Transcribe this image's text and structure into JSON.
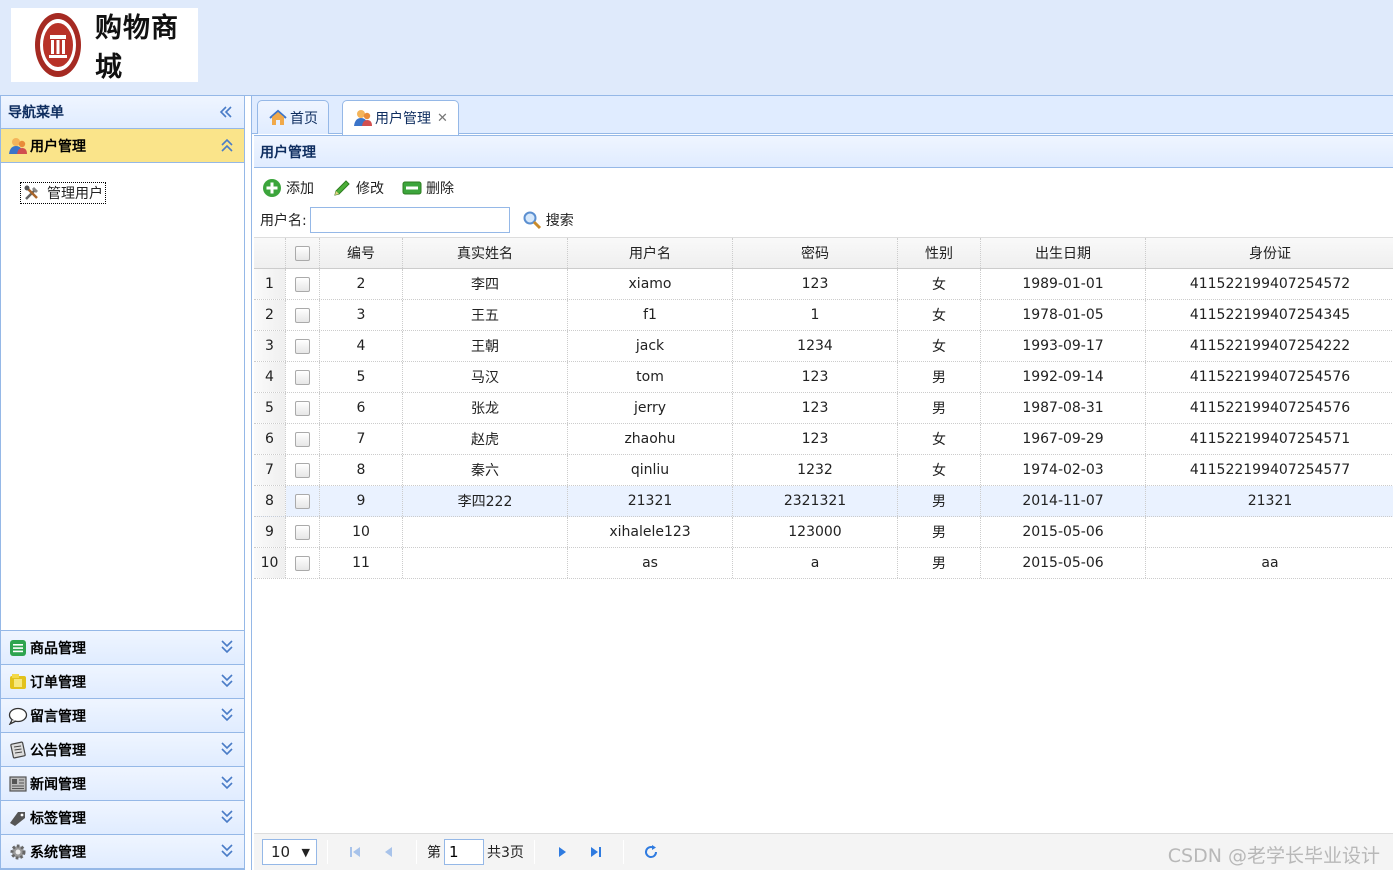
{
  "header": {
    "logo_text": "购物商城",
    "seal_icon": "university-seal-icon"
  },
  "nav": {
    "title": "导航菜单",
    "active_section": {
      "label": "用户管理",
      "items": [
        {
          "label": "管理用户",
          "icon": "tools-icon"
        }
      ]
    },
    "sections": [
      {
        "label": "商品管理",
        "icon": "list-icon"
      },
      {
        "label": "订单管理",
        "icon": "folder-icon"
      },
      {
        "label": "留言管理",
        "icon": "comment-icon"
      },
      {
        "label": "公告管理",
        "icon": "note-icon"
      },
      {
        "label": "新闻管理",
        "icon": "news-icon"
      },
      {
        "label": "标签管理",
        "icon": "tag-icon"
      },
      {
        "label": "系统管理",
        "icon": "gear-icon"
      }
    ]
  },
  "tabs": [
    {
      "label": "首页",
      "icon": "home-icon"
    },
    {
      "label": "用户管理",
      "icon": "users-icon",
      "closable": true
    }
  ],
  "panel": {
    "title": "用户管理"
  },
  "toolbar": {
    "add_label": "添加",
    "edit_label": "修改",
    "delete_label": "删除"
  },
  "search": {
    "label": "用户名:",
    "value": "",
    "button_label": "搜索"
  },
  "grid": {
    "columns": [
      "编号",
      "真实姓名",
      "用户名",
      "密码",
      "性别",
      "出生日期",
      "身份证"
    ],
    "rows": [
      {
        "n": "1",
        "id": "2",
        "realname": "李四",
        "username": "xiamo",
        "password": "123",
        "sex": "女",
        "birthday": "1989-01-01",
        "idcard": "411522199407254572"
      },
      {
        "n": "2",
        "id": "3",
        "realname": "王五",
        "username": "f1",
        "password": "1",
        "sex": "女",
        "birthday": "1978-01-05",
        "idcard": "411522199407254345"
      },
      {
        "n": "3",
        "id": "4",
        "realname": "王朝",
        "username": "jack",
        "password": "1234",
        "sex": "女",
        "birthday": "1993-09-17",
        "idcard": "411522199407254222"
      },
      {
        "n": "4",
        "id": "5",
        "realname": "马汉",
        "username": "tom",
        "password": "123",
        "sex": "男",
        "birthday": "1992-09-14",
        "idcard": "411522199407254576"
      },
      {
        "n": "5",
        "id": "6",
        "realname": "张龙",
        "username": "jerry",
        "password": "123",
        "sex": "男",
        "birthday": "1987-08-31",
        "idcard": "411522199407254576"
      },
      {
        "n": "6",
        "id": "7",
        "realname": "赵虎",
        "username": "zhaohu",
        "password": "123",
        "sex": "女",
        "birthday": "1967-09-29",
        "idcard": "411522199407254571"
      },
      {
        "n": "7",
        "id": "8",
        "realname": "秦六",
        "username": "qinliu",
        "password": "1232",
        "sex": "女",
        "birthday": "1974-02-03",
        "idcard": "411522199407254577"
      },
      {
        "n": "8",
        "id": "9",
        "realname": "李四222",
        "username": "21321",
        "password": "2321321",
        "sex": "男",
        "birthday": "2014-11-07",
        "idcard": "21321",
        "highlighted": true
      },
      {
        "n": "9",
        "id": "10",
        "realname": "",
        "username": "xihalele123",
        "password": "123000",
        "sex": "男",
        "birthday": "2015-05-06",
        "idcard": ""
      },
      {
        "n": "10",
        "id": "11",
        "realname": "",
        "username": "as",
        "password": "a",
        "sex": "男",
        "birthday": "2015-05-06",
        "idcard": "aa"
      }
    ]
  },
  "pager": {
    "page_size": "10",
    "page_prefix": "第",
    "current_page": "1",
    "total_label": "共3页"
  },
  "watermark": "CSDN @老学长毕业设计",
  "colors": {
    "border": "#95b8e7",
    "header_bg": "#dfeafb",
    "active_accordion": "#fae48a",
    "row_highlight": "#eaf2ff"
  }
}
